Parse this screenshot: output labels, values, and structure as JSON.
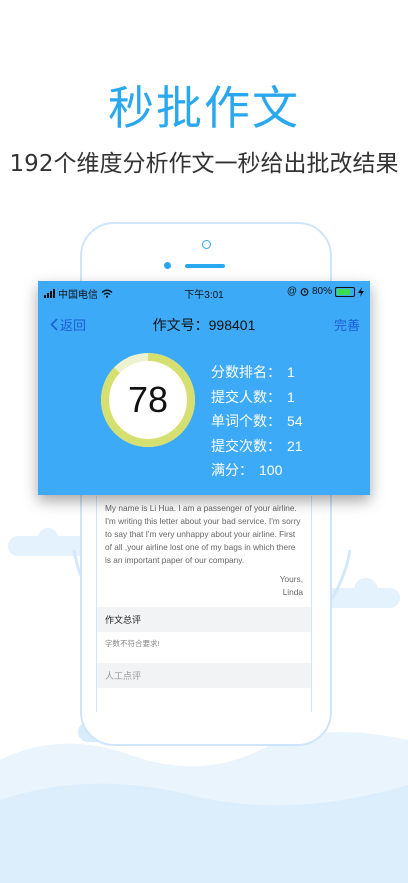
{
  "headline": "秒批作文",
  "subheadline": "192个维度分析作文一秒给出批改结果",
  "status_bar": {
    "carrier": "中国电信",
    "time": "下午3:01",
    "battery": "80%",
    "battery_level": 0.8
  },
  "nav": {
    "back_label": "返回",
    "title": "作文号：998401",
    "done_label": "完善"
  },
  "score": {
    "value": "78",
    "progress": 0.87
  },
  "stats": [
    {
      "label": "分数排名：",
      "value": "1"
    },
    {
      "label": "提交人数：",
      "value": "1"
    },
    {
      "label": "单词个数：",
      "value": "54"
    },
    {
      "label": "提交次数：",
      "value": "21"
    },
    {
      "label": "满分：",
      "value": "100"
    }
  ],
  "essay": {
    "text": "My name is Li Hua. I am a passenger of your airline. I'm writing this letter about your bad service. I'm sorry to say that I'm very unhappy about your airline. First of all ,your airline lost one of my bags in which there is an important paper of our company.",
    "closing": "Yours,",
    "signature": "Linda"
  },
  "review": {
    "heading": "作文总评",
    "body": "字数不符合要求!"
  },
  "manual_review": {
    "heading": "人工点评"
  },
  "colors": {
    "accent": "#2aa8ef",
    "card": "#3daaf8",
    "ring": "#d6e070"
  }
}
